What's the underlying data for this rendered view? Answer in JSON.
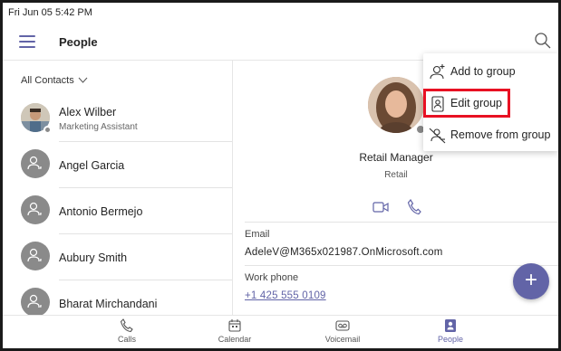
{
  "status_bar": {
    "datetime": "Fri Jun 05  5:42 PM"
  },
  "header": {
    "title": "People"
  },
  "contacts": {
    "filter_label": "All Contacts",
    "items": [
      {
        "name": "Alex Wilber",
        "subtitle": "Marketing Assistant"
      },
      {
        "name": "Angel Garcia",
        "subtitle": ""
      },
      {
        "name": "Antonio Bermejo",
        "subtitle": ""
      },
      {
        "name": "Aubury Smith",
        "subtitle": ""
      },
      {
        "name": "Bharat Mirchandani",
        "subtitle": ""
      }
    ]
  },
  "profile": {
    "job_title": "Retail Manager",
    "department": "Retail",
    "email_label": "Email",
    "email_value": "AdeleV@M365x021987.OnMicrosoft.com",
    "phone_label": "Work phone",
    "phone_value": "+1 425 555 0109"
  },
  "menu": {
    "items": [
      {
        "label": "Add to group",
        "icon": "add-person-icon"
      },
      {
        "label": "Edit group",
        "icon": "edit-group-icon"
      },
      {
        "label": "Remove from group",
        "icon": "remove-person-icon"
      }
    ]
  },
  "fab": {
    "glyph": "+"
  },
  "bottom_nav": {
    "items": [
      {
        "label": "Calls",
        "icon": "phone-icon"
      },
      {
        "label": "Calendar",
        "icon": "calendar-icon"
      },
      {
        "label": "Voicemail",
        "icon": "voicemail-icon"
      },
      {
        "label": "People",
        "icon": "people-icon",
        "active": true
      }
    ]
  },
  "colors": {
    "accent": "#6264a7",
    "highlight": "#e81123",
    "avatar_gray": "#8a8a8a"
  }
}
